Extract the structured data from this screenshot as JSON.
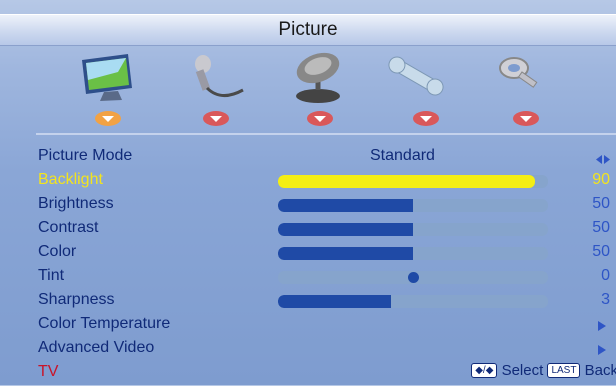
{
  "menu": {
    "title": "Picture"
  },
  "icons": [
    {
      "name": "picture-icon",
      "selected": true
    },
    {
      "name": "audio-icon",
      "selected": false
    },
    {
      "name": "timer-icon",
      "selected": false
    },
    {
      "name": "setup-icon",
      "selected": false
    },
    {
      "name": "lock-icon",
      "selected": false
    }
  ],
  "items": [
    {
      "label": "Picture Mode",
      "value": "Standard",
      "type": "select"
    },
    {
      "label": "Backlight",
      "value": "90",
      "type": "slider",
      "level": 0.95,
      "active": true
    },
    {
      "label": "Brightness",
      "value": "50",
      "type": "slider",
      "level": 0.5
    },
    {
      "label": "Contrast",
      "value": "50",
      "type": "slider",
      "level": 0.5
    },
    {
      "label": "Color",
      "value": "50",
      "type": "slider",
      "level": 0.5
    },
    {
      "label": "Tint",
      "value": "0",
      "type": "center",
      "level": 0.5
    },
    {
      "label": "Sharpness",
      "value": "3",
      "type": "slider",
      "level": 0.42
    },
    {
      "label": "Color Temperature",
      "type": "submenu"
    },
    {
      "label": "Advanced Video",
      "type": "submenu"
    }
  ],
  "footer": {
    "input": "TV",
    "nav_glyph": "◆/◆",
    "select_label": "Select",
    "last_key": "LAST",
    "back_label": "Back"
  },
  "colors": {
    "active": "#f3e41e",
    "label": "#102a78",
    "input": "#c8142a"
  }
}
